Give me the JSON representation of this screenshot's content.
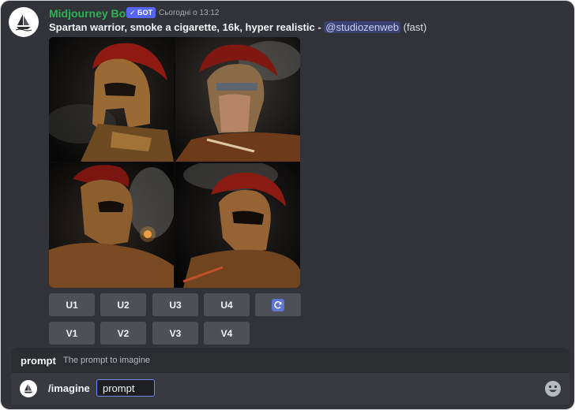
{
  "message": {
    "author": "Midjourney Bot",
    "badge": "✓ БОТ",
    "timestamp": "Сьогодні о 13:12",
    "prompt": "Spartan warrior, smoke a cigarette, 16k, hyper realistic",
    "separator": " - ",
    "mention": "@studiozenweb",
    "speed": "(fast)",
    "image_alt": "Four AI-generated images of Spartan warriors with red-crested helmets smoking"
  },
  "buttons": {
    "upscale": [
      "U1",
      "U2",
      "U3",
      "U4"
    ],
    "variation": [
      "V1",
      "V2",
      "V3",
      "V4"
    ],
    "reroll_icon": "refresh-icon"
  },
  "composer": {
    "hint_name": "prompt",
    "hint_description": "The prompt to imagine",
    "command": "/imagine",
    "option": "prompt",
    "emoji_icon": "emoji-icon"
  },
  "colors": {
    "background": "#313338",
    "author": "#2fb257",
    "badge": "#5865f2",
    "mention_bg": "#3c4270",
    "button": "#4e5058",
    "reroll": "#5e74d6",
    "crest_red": "#8e1a12",
    "bronze": "#9a6a34"
  }
}
